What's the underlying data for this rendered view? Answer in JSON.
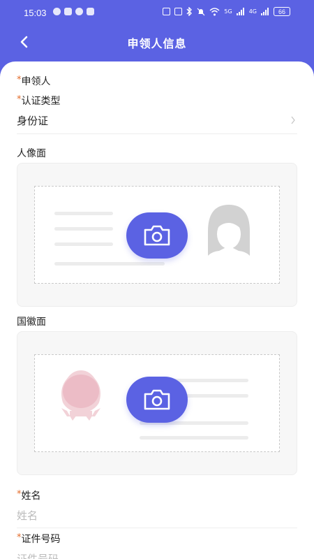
{
  "status_bar": {
    "time": "15:03",
    "network_label": "5G",
    "network_label2": "4G",
    "battery": "66"
  },
  "header": {
    "title": "申领人信息"
  },
  "form": {
    "applicant_label": "申领人",
    "cert_type_label": "认证类型",
    "cert_type_value": "身份证",
    "portrait_side_label": "人像面",
    "emblem_side_label": "国徽面",
    "name_label": "姓名",
    "name_placeholder": "姓名",
    "id_number_label": "证件号码",
    "id_number_placeholder": "证件号码",
    "required_mark": "*"
  },
  "colors": {
    "accent": "#5b62e3",
    "required": "#e36b2a",
    "emblem": "#f0c8cf",
    "avatar": "#cfcfcf"
  },
  "icons": {
    "back": "chevron-left",
    "select": "chevron-right",
    "upload": "camera"
  }
}
